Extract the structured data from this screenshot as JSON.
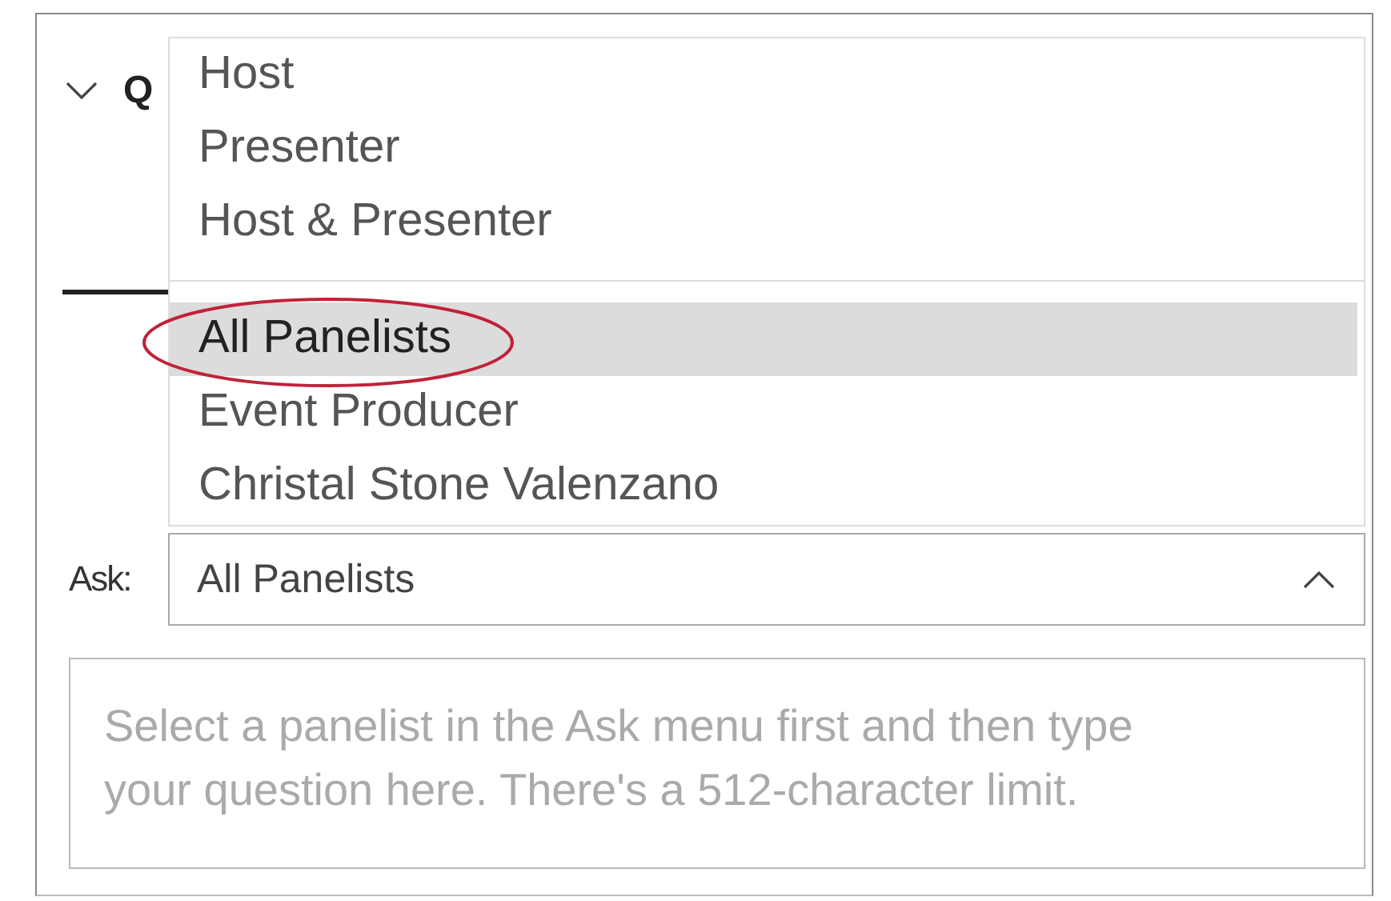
{
  "panel": {
    "header": {
      "title": "Q",
      "expanded": true
    }
  },
  "dropdown": {
    "option_groups": [
      {
        "options": [
          {
            "label": "Host",
            "selected": false,
            "circled": false
          },
          {
            "label": "Presenter",
            "selected": false,
            "circled": false
          },
          {
            "label": "Host & Presenter",
            "selected": false,
            "circled": false
          }
        ]
      },
      {
        "options": [
          {
            "label": "All Panelists",
            "selected": true,
            "circled": true
          },
          {
            "label": "Event Producer",
            "selected": false,
            "circled": false
          },
          {
            "label": "Christal Stone Valenzano",
            "selected": false,
            "circled": false
          }
        ]
      }
    ]
  },
  "ask": {
    "label": "Ask:",
    "value": "All Panelists",
    "expanded": true
  },
  "question": {
    "placeholder": "Select a panelist in the Ask menu first and then type your question here. There's a 512-character limit."
  }
}
